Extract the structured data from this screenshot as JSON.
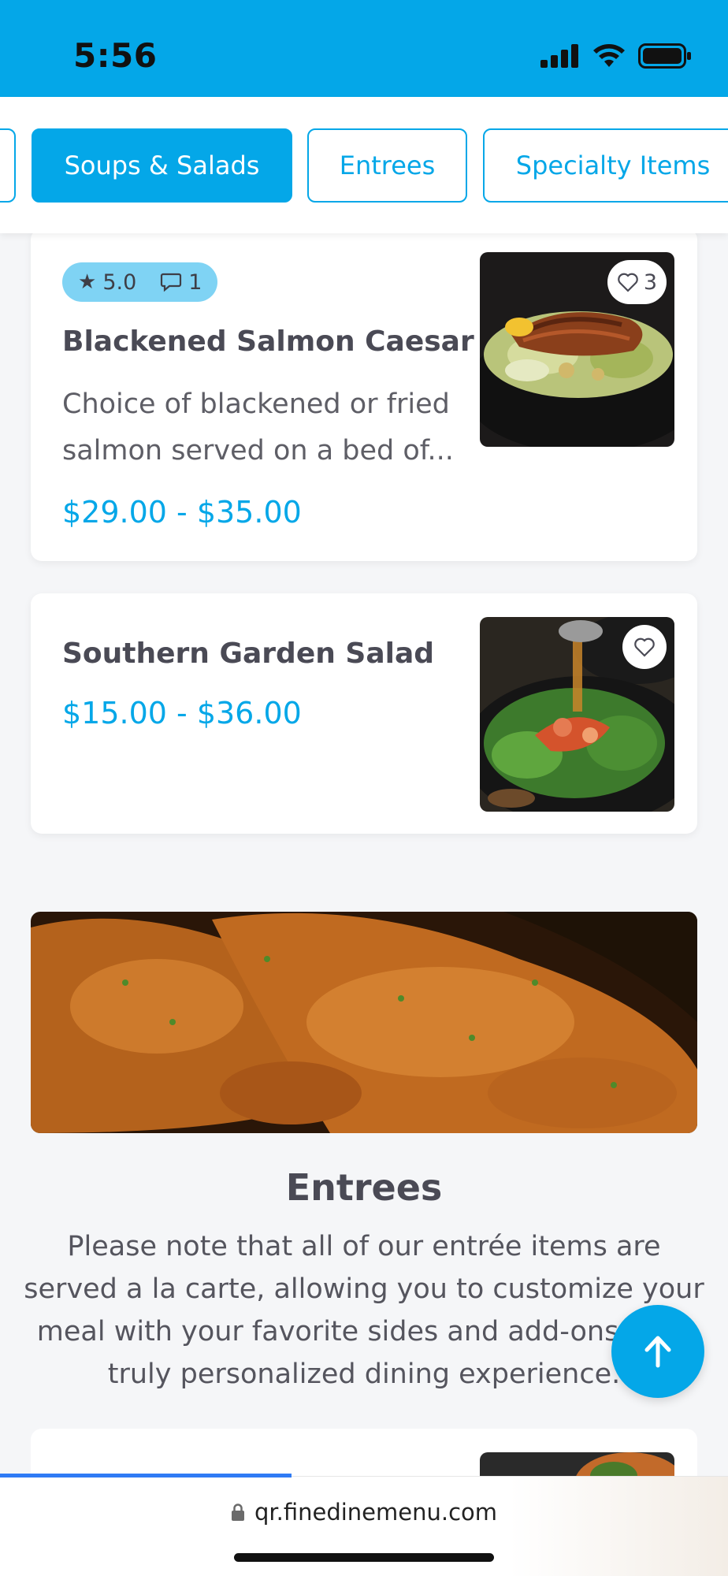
{
  "status_bar": {
    "time": "5:56",
    "background_color": "#04a7e8"
  },
  "tabs": [
    {
      "label": "",
      "active": false
    },
    {
      "label": "Soups & Salads",
      "active": true
    },
    {
      "label": "Entrees",
      "active": false
    },
    {
      "label": "Specialty Items",
      "active": false
    }
  ],
  "items": [
    {
      "name": "Blackened Salmon Caesar",
      "description": "Choice of blackened or fried salmon served on a bed of...",
      "price": "$29.00 - $35.00",
      "rating": "5.0",
      "comments": "1",
      "favorites": "3",
      "image_icon": "salmon-salad-image"
    },
    {
      "name": "Southern Garden Salad",
      "price": "$15.00 - $36.00",
      "image_icon": "garden-salad-image"
    }
  ],
  "section": {
    "title": "Entrees",
    "description": "Please note that all of our entrée items are served a la carte, allowing you to customize your meal with your favorite sides and add-ons for a truly personalized dining experience.",
    "banner_icon": "fried-chicken-image"
  },
  "browser": {
    "url": "qr.finedinemenu.com",
    "load_progress": 0.4
  },
  "colors": {
    "accent": "#04a7e8",
    "badge": "#7fd3f4"
  }
}
